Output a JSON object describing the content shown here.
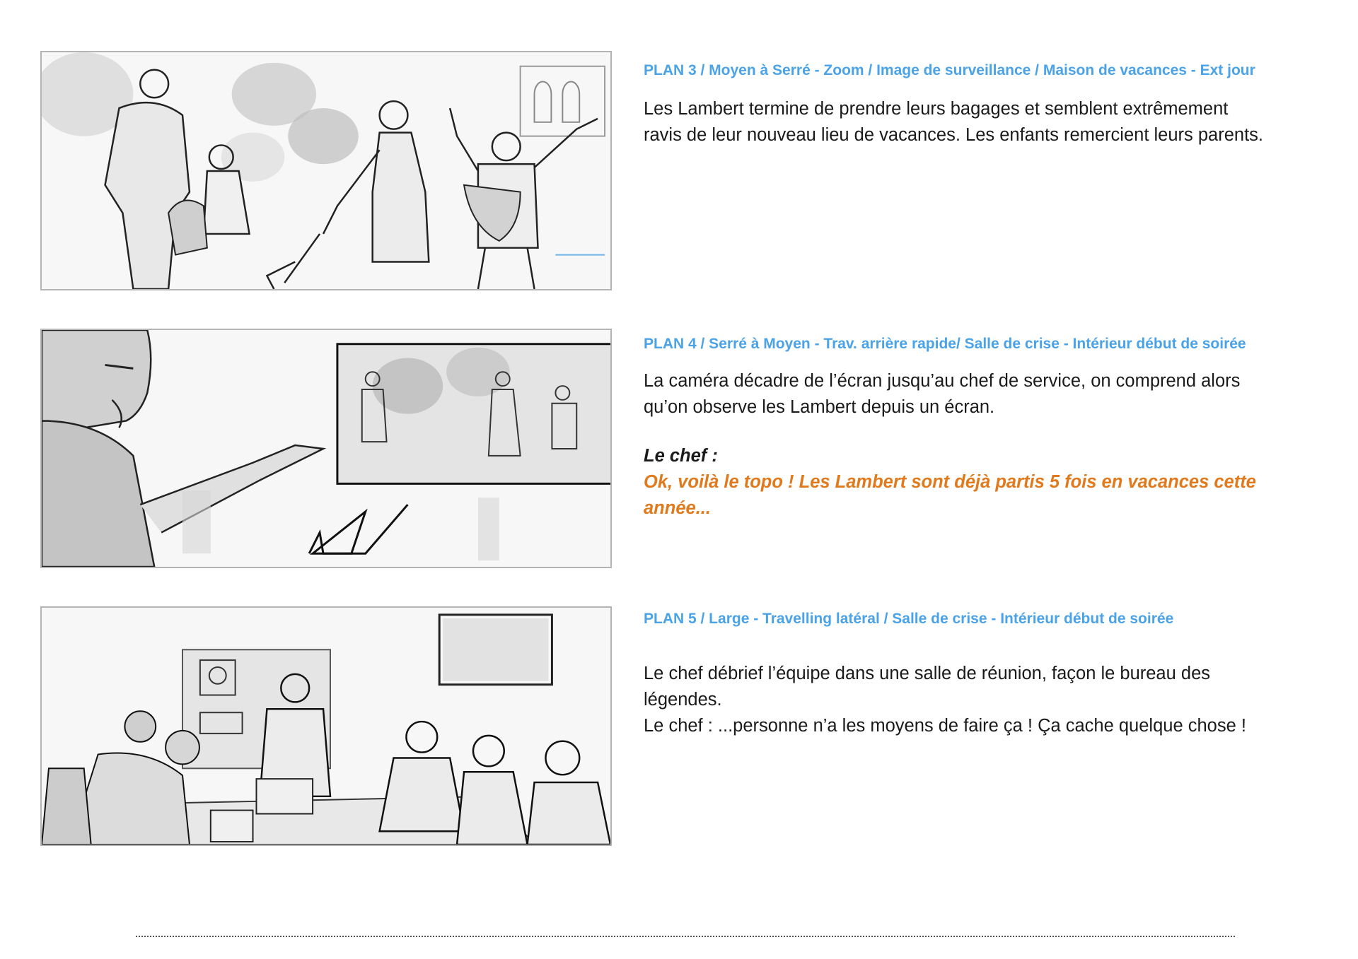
{
  "plans": [
    {
      "header": "PLAN 3 / Moyen à Serré - Zoom / Image de surveillance / Maison de vacances - Ext jour",
      "description": [
        "Les Lambert termine de prendre leurs bagages et semblent extrêmement",
        "ravis de leur nouveau lieu de vacances. Les enfants remercient leurs parents."
      ]
    },
    {
      "header": "PLAN 4 / Serré à Moyen - Trav. arrière  rapide/  Salle de crise - Intérieur début de soirée",
      "description": [
        "La caméra décadre de l’écran jusqu’au chef de service, on comprend alors",
        "qu’on observe les Lambert depuis un écran."
      ],
      "speaker": "Le chef :",
      "dialogue": [
        "Ok, voilà le topo ! Les Lambert sont déjà partis 5 fois en vacances cette",
        "année..."
      ]
    },
    {
      "header": "PLAN 5  / Large - Travelling latéral /  Salle de crise - Intérieur début de soirée",
      "description": [
        "Le chef débrief l’équipe dans une salle de réunion, façon le bureau des",
        "légendes.",
        "Le chef : ...personne n’a les moyens de faire ça ! Ça cache quelque chose !"
      ]
    }
  ],
  "colors": {
    "header_blue": "#4aa3e8",
    "dialogue_orange": "#e07a1c",
    "text": "#1a1a1a",
    "frame_border": "#b4b4b4"
  }
}
